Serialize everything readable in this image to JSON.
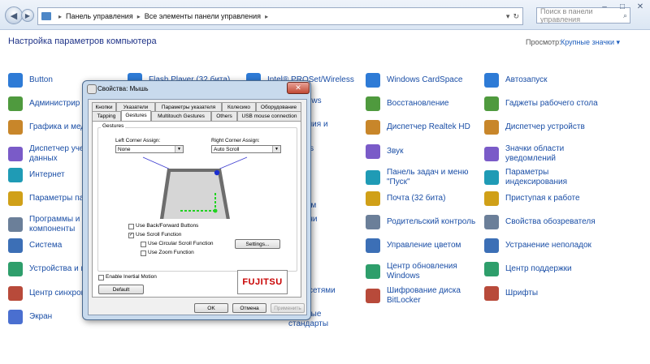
{
  "address": {
    "breadcrumb": [
      "Панель управления",
      "Все элементы панели управления"
    ],
    "search_placeholder": "Поиск в панели управления"
  },
  "window_controls": {
    "minimize": "–",
    "maximize": "□",
    "close": "✕"
  },
  "header": {
    "title": "Настройка параметров компьютера",
    "view_label": "Просмотр:",
    "view_value": "Крупные значки ▾"
  },
  "items": {
    "col1": [
      "Button",
      "Администрирование",
      "Графика и медиа",
      "Диспетчер учетных данных",
      "Интернет",
      "Параметры папок",
      "Программы и компоненты",
      "Система",
      "Устройства и принтеры",
      "Центр синхронизации",
      "Экран"
    ],
    "col1_shown": [
      "Button",
      "Администрир",
      "Графика и меди",
      "Диспетчер учет|данных",
      "Интернет",
      "Параметры пап",
      "Программы и|компоненты",
      "Система",
      "Устройства и пр",
      "Центр синхрони",
      "Экран"
    ],
    "col2_shown": [
      "Flash Player (32 бита)"
    ],
    "col3_shown": [
      "Intel® PROSet/Wireless",
      "Windows",
      "ложения и|ы",
      "indows",
      "к",
      "и|абочим",
      "ие речи",
      "ядем",
      "ности",
      "ение сетями|ом",
      "нальные|стандарты"
    ],
    "col4": [
      "Windows CardSpace",
      "Восстановление",
      "Диспетчер Realtek HD",
      "Звук",
      "Панель задач и меню|\"Пуск\"",
      "Почта (32 бита)",
      "Родительский контроль",
      "Управление цветом",
      "Центр обновления|Windows",
      "Шифрование диска|BitLocker"
    ],
    "col5": [
      "Автозапуск",
      "Гаджеты рабочего стола",
      "Диспетчер устройств",
      "Значки области|уведомлений",
      "Параметры|индексирования",
      "Приступая к работе",
      "Свойства обозревателя",
      "Устранение неполадок",
      "Центр поддержки",
      "Шрифты"
    ]
  },
  "dialog": {
    "title": "Свойства: Мышь",
    "close": "✕",
    "tabs_row1": [
      "Кнопки",
      "Указатели",
      "Параметры указателя",
      "Колесико",
      "Оборудование"
    ],
    "tabs_row2": [
      "Tapping",
      "Gestures",
      "Multitouch Gestures",
      "Others",
      "USB mouse connection"
    ],
    "group_label": "Gestures",
    "left_corner_label": "Left Corner Assign:",
    "left_corner_value": "None",
    "right_corner_label": "Right Corner Assign:",
    "right_corner_value": "Auto Scroll",
    "options": [
      {
        "label": "Use Back/Forward Buttons",
        "checked": false
      },
      {
        "label": "Use Scroll Function",
        "checked": true
      },
      {
        "label": "Use Circular Scroll Function",
        "checked": false
      },
      {
        "label": "Use Zoom Function",
        "checked": false
      }
    ],
    "settings_button": "Settings...",
    "inertial_label": "Enable Inertial Motion",
    "default_button": "Default",
    "brand": "FUJITSU",
    "ok_button": "OK",
    "cancel_button": "Отмена",
    "apply_button": "Применить"
  },
  "colors": {
    "link": "#1a4ea6",
    "title": "#1e3287",
    "dialog_frame": "#c8daed",
    "gesture_green": "#21d321"
  }
}
